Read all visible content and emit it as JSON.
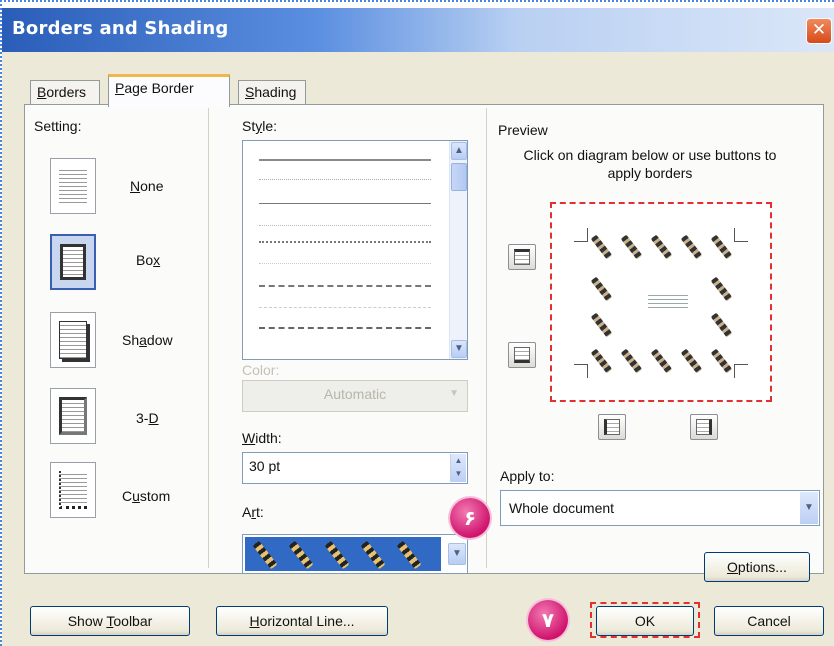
{
  "window": {
    "title": "Borders and Shading"
  },
  "tabs": [
    {
      "label": "Borders",
      "mnemonic": "B",
      "rest": "orders"
    },
    {
      "label": "Page Border",
      "mnemonic": "P",
      "rest": "age Border"
    },
    {
      "label": "Shading",
      "mnemonic": "S",
      "rest": "hading"
    }
  ],
  "setting": {
    "label": "Setting:",
    "options": [
      {
        "label": "None",
        "pre": "",
        "mnemonic": "N",
        "post": "one"
      },
      {
        "label": "Box",
        "pre": "Bo",
        "mnemonic": "x",
        "post": ""
      },
      {
        "label": "Shadow",
        "pre": "Sh",
        "mnemonic": "a",
        "post": "dow"
      },
      {
        "label": "3-D",
        "pre": "3-",
        "mnemonic": "D",
        "post": ""
      },
      {
        "label": "Custom",
        "pre": "C",
        "mnemonic": "u",
        "post": "stom"
      }
    ],
    "selected": "Box"
  },
  "style": {
    "pre": "St",
    "mnemonic": "y",
    "post": "le:"
  },
  "color": {
    "label": "Color:",
    "value": "Automatic"
  },
  "width": {
    "mnemonic": "W",
    "post": "idth:",
    "value": "30 pt"
  },
  "art": {
    "pre": "A",
    "mnemonic": "r",
    "post": "t:"
  },
  "preview": {
    "label": "Preview",
    "help": "Click on diagram below or use buttons to apply borders"
  },
  "apply_to": {
    "label": "Apply to:",
    "value": "Whole document"
  },
  "buttons": {
    "options": {
      "mnemonic": "O",
      "post": "ptions..."
    },
    "show_toolbar": {
      "pre": "Show ",
      "mnemonic": "T",
      "post": "oolbar"
    },
    "horizontal_line": {
      "mnemonic": "H",
      "post": "orizontal Line..."
    },
    "ok": "OK",
    "cancel": "Cancel"
  },
  "badges": {
    "art": "۶",
    "ok": "۷"
  },
  "colors": {
    "title_bar": "#2a5db8",
    "selection": "#316ac5",
    "badge": "#d0146e",
    "focus_dash": "#e03030"
  },
  "icons": [
    "close-icon",
    "scroll-up-icon",
    "scroll-down-icon",
    "dropdown-arrow-icon",
    "spin-icon",
    "top-border-icon",
    "bottom-border-icon",
    "left-border-icon",
    "right-border-icon"
  ]
}
